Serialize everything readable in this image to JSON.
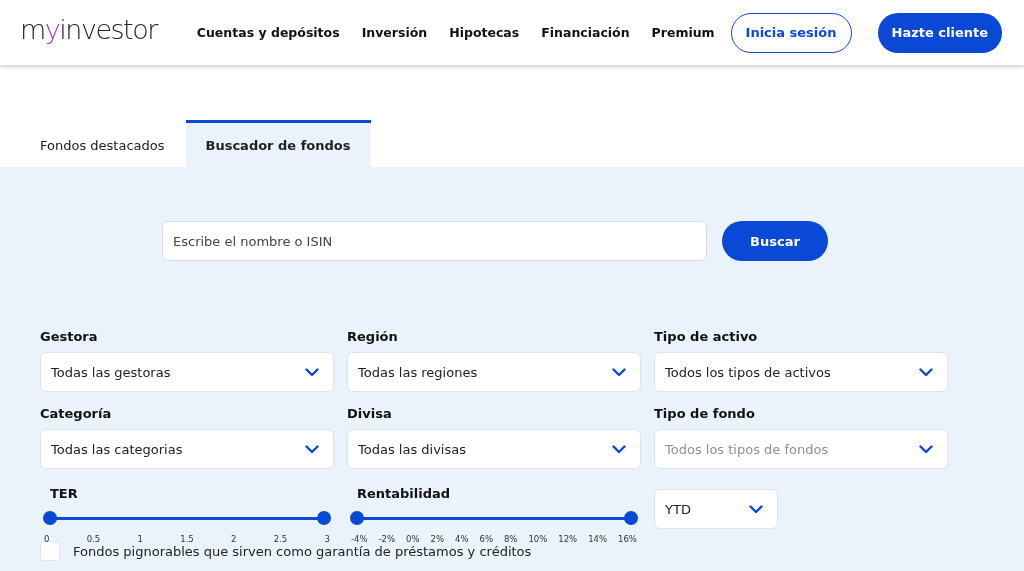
{
  "header": {
    "logo": [
      {
        "text": "m",
        "color": "#222222"
      },
      {
        "text": "y",
        "color": "#9b3fd6"
      },
      {
        "text": "investor",
        "color": "#222222"
      }
    ],
    "nav": [
      "Cuentas y depósitos",
      "Inversión",
      "Hipotecas",
      "Financiación",
      "Premium"
    ],
    "buttons": [
      {
        "label": "Inicia sesión",
        "kind": "outline"
      },
      {
        "label": "Hazte cliente",
        "kind": "filled"
      }
    ]
  },
  "tabs": [
    {
      "label": "Fondos destacados",
      "selected": false
    },
    {
      "label": "Buscador de fondos",
      "selected": true
    }
  ],
  "search": {
    "placeholder": "Escribe el nombre o ISIN",
    "button": "Buscar"
  },
  "filters": [
    {
      "label": "Gestora",
      "value": "Todas las gestoras",
      "disabled": false
    },
    {
      "label": "Región",
      "value": "Todas las regiones",
      "disabled": false
    },
    {
      "label": "Tipo de activo",
      "value": "Todos los tipos de activos",
      "disabled": false
    },
    {
      "label": "Categoría",
      "value": "Todas las categorias",
      "disabled": false
    },
    {
      "label": "Divisa",
      "value": "Todas las divisas",
      "disabled": false
    },
    {
      "label": "Tipo de fondo",
      "value": "Todos los tipos de fondos",
      "disabled": true
    }
  ],
  "sliders": [
    {
      "label": "TER",
      "thumbs": [
        {
          "level": 0
        },
        {
          "level": 1
        }
      ],
      "ticks": [
        "0",
        "0.5",
        "1",
        "1.5",
        "2",
        "2.5",
        "3"
      ]
    },
    {
      "label": "Rentabilidad",
      "thumbs": [
        {
          "level": 0
        },
        {
          "level": 1
        }
      ],
      "ticks": [
        "-4%",
        "-2%",
        "0%",
        "2%",
        "4%",
        "6%",
        "8%",
        "10%",
        "12%",
        "14%",
        "16%"
      ]
    }
  ],
  "period": {
    "value": "YTD"
  },
  "checkbox": {
    "label": "Fondos pignorables que sirven como garantía de préstamos y créditos",
    "checked": false
  }
}
